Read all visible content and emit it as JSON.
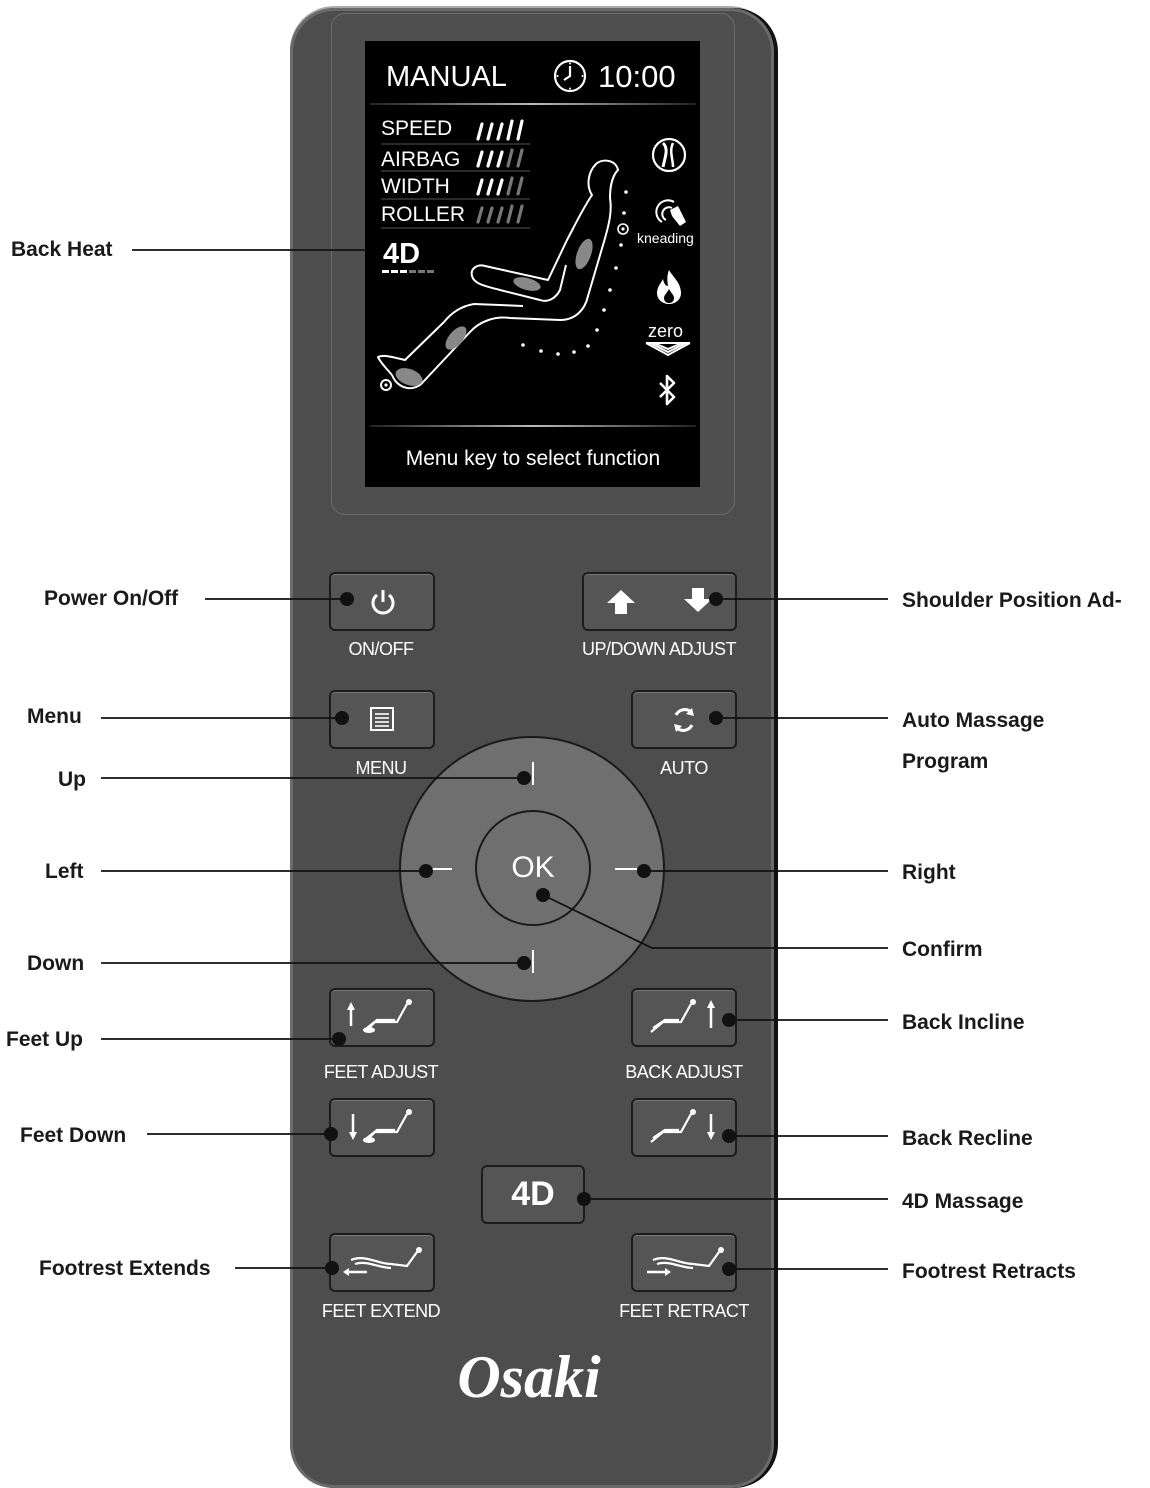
{
  "callouts": {
    "back_heat": "Back Heat",
    "power": "Power On/Off",
    "shoulder": "Shoulder Position Ad-",
    "menu": "Menu",
    "auto_line1": "Auto Massage",
    "auto_line2": "Program",
    "up": "Up",
    "left": "Left",
    "right": "Right",
    "confirm": "Confirm",
    "down": "Down",
    "feet_up": "Feet Up",
    "back_incline": "Back Incline",
    "feet_down": "Feet Down",
    "back_recline": "Back Recline",
    "massage_4d": "4D Massage",
    "footrest_extends": "Footrest Extends",
    "footrest_retracts": "Footrest Retracts"
  },
  "screen": {
    "mode": "MANUAL",
    "timer": "10:00",
    "rows": [
      "SPEED",
      "AIRBAG",
      "WIDTH",
      "ROLLER"
    ],
    "badge_4d": "4D",
    "kneading": "kneading",
    "zero": "zero",
    "hint": "Menu key to select function"
  },
  "buttons": {
    "onoff": "ON/OFF",
    "updown": "UP/DOWN ADJUST",
    "menu": "MENU",
    "auto": "AUTO",
    "ok": "OK",
    "feet_adjust": "FEET ADJUST",
    "back_adjust": "BACK ADJUST",
    "b4d": "4D",
    "feet_extend": "FEET EXTEND",
    "feet_retract": "FEET RETRACT"
  },
  "brand": "Osaki",
  "colors": {
    "body": "#4d4d4d",
    "screen": "#000000",
    "button": "#555555",
    "dpad": "#6f6f6f"
  }
}
